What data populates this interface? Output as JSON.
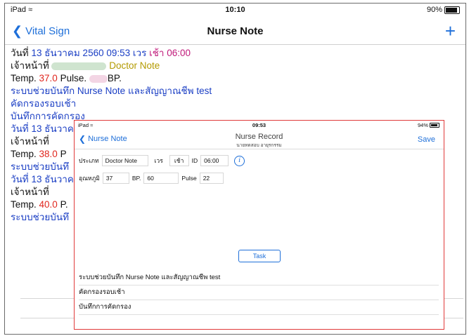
{
  "status": {
    "device": "iPad",
    "time": "10:10",
    "battery": "90%"
  },
  "nav": {
    "back_label": "Vital Sign",
    "title": "Nurse Note",
    "add_label": "+"
  },
  "notes": [
    {
      "date_prefix": "วันที่",
      "date": "13 ธันวาคม 2560 09:53",
      "shift_label": "เวร",
      "shift": "เช้า",
      "shift_time": "06:00",
      "staff_label": "เจ้าหน้าที่",
      "doctor_note": "Doctor Note",
      "temp_label": "Temp.",
      "temp": "37.0",
      "pulse_label": "Pulse.",
      "bp_label": "BP.",
      "text_line1": "ระบบช่วยบันทึก Nurse Note และสัญญาณชีพ test",
      "text_line2": "คัดกรองรอบเช้า",
      "text_line3": "บันทึกการคัดกรอง"
    },
    {
      "date_prefix": "วันที่ 13 ธันวาค",
      "staff_label": "เจ้าหน้าที่",
      "temp_label": "Temp.",
      "temp": "38.0",
      "temp_suffix": "P",
      "text_line1": "ระบบช่วยบันทึ"
    },
    {
      "date_prefix": "วันที่ 13 ธันวาค",
      "staff_label": "เจ้าหน้าที่",
      "temp_label": "Temp.",
      "temp": "40.0",
      "temp_suffix": "P.",
      "text_line1": "ระบบช่วยบันทึ"
    }
  ],
  "popup": {
    "status": {
      "device": "iPad",
      "time": "09:53",
      "battery": "94%"
    },
    "nav": {
      "back_label": "Nurse Note",
      "title": "Nurse Record",
      "subtitle": "นายทดสอบ อายุรกรรม",
      "save_label": "Save"
    },
    "row1": {
      "type_label": "ประเภท",
      "type_value": "Doctor Note",
      "shift_label": "เวร",
      "shift_value": "เช้า",
      "id_label": "ID",
      "id_value": "06:00"
    },
    "row2": {
      "temp_label": "อุณหภูมิ",
      "temp_value": "37",
      "bp_label": "BP.",
      "bp_value": "60",
      "pulse_label": "Pulse",
      "pulse_value": "22"
    },
    "task_label": "Task",
    "list": [
      "ระบบช่วยบันทึก Nurse Note และสัญญาณชีพ test",
      "คัดกรองรอบเช้า",
      "บันทึกการคัดกรอง"
    ]
  }
}
